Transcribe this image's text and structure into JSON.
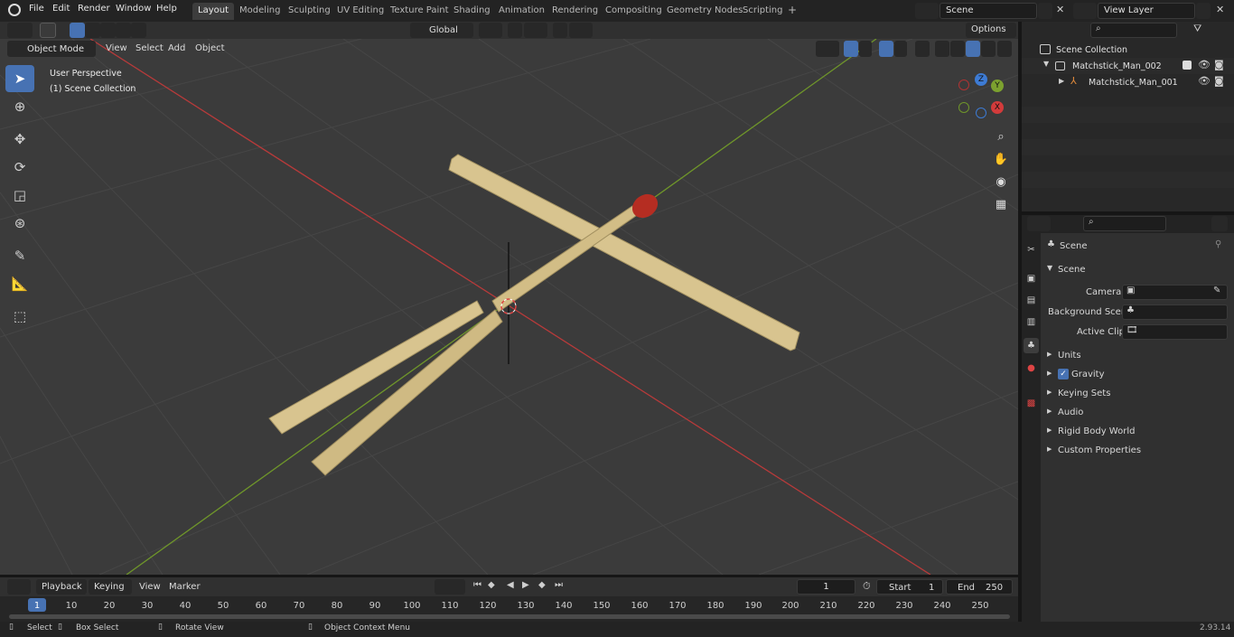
{
  "app": {
    "version": "2.93.14"
  },
  "menu": [
    "File",
    "Edit",
    "Render",
    "Window",
    "Help"
  ],
  "workspaces": [
    {
      "label": "Layout",
      "active": true
    },
    {
      "label": "Modeling"
    },
    {
      "label": "Sculpting"
    },
    {
      "label": "UV Editing"
    },
    {
      "label": "Texture Paint"
    },
    {
      "label": "Shading"
    },
    {
      "label": "Animation"
    },
    {
      "label": "Rendering"
    },
    {
      "label": "Compositing"
    },
    {
      "label": "Geometry Nodes"
    },
    {
      "label": "Scripting"
    },
    {
      "label": "+"
    }
  ],
  "scene_field": "Scene",
  "view_layer_field": "View Layer",
  "viewport_header": {
    "mode": "Object Mode",
    "menus": [
      "View",
      "Select",
      "Add",
      "Object"
    ],
    "transform_orientation": "Global",
    "options": "Options"
  },
  "viewport": {
    "title": "User Perspective",
    "subtitle": "(1) Scene Collection",
    "gizmo": {
      "x": "X",
      "y": "Y",
      "z": "Z"
    }
  },
  "outliner": {
    "search_placeholder": "",
    "root": "Scene Collection",
    "items": [
      {
        "label": "Matchstick_Man_002",
        "level": 1
      },
      {
        "label": "Matchstick_Man_001",
        "level": 2
      }
    ]
  },
  "properties": {
    "header": "Scene",
    "section": "Scene",
    "fields": [
      {
        "label": "Camera",
        "value": ""
      },
      {
        "label": "Background Scene",
        "value": ""
      },
      {
        "label": "Active Clip",
        "value": ""
      }
    ],
    "panels": [
      "Units",
      "Gravity",
      "Keying Sets",
      "Audio",
      "Rigid Body World",
      "Custom Properties"
    ]
  },
  "timeline": {
    "menus": [
      "Playback",
      "Keying",
      "View",
      "Marker"
    ],
    "current_frame": "1",
    "start_label": "Start",
    "start": "1",
    "end_label": "End",
    "end": "250",
    "ruler": [
      "1",
      "10",
      "20",
      "30",
      "40",
      "50",
      "60",
      "70",
      "80",
      "90",
      "100",
      "110",
      "120",
      "130",
      "140",
      "150",
      "160",
      "170",
      "180",
      "190",
      "200",
      "210",
      "220",
      "230",
      "240",
      "250"
    ]
  },
  "statusbar": {
    "select": "Select",
    "box_select": "Box Select",
    "rotate": "Rotate View",
    "context": "Object Context Menu"
  },
  "colors": {
    "accent": "#4772b3",
    "x_axis": "#d23b3b",
    "y_axis": "#7ca12f",
    "z_axis": "#3d7bd4",
    "wood": "#d8c48f",
    "match_head": "#b52d22"
  }
}
